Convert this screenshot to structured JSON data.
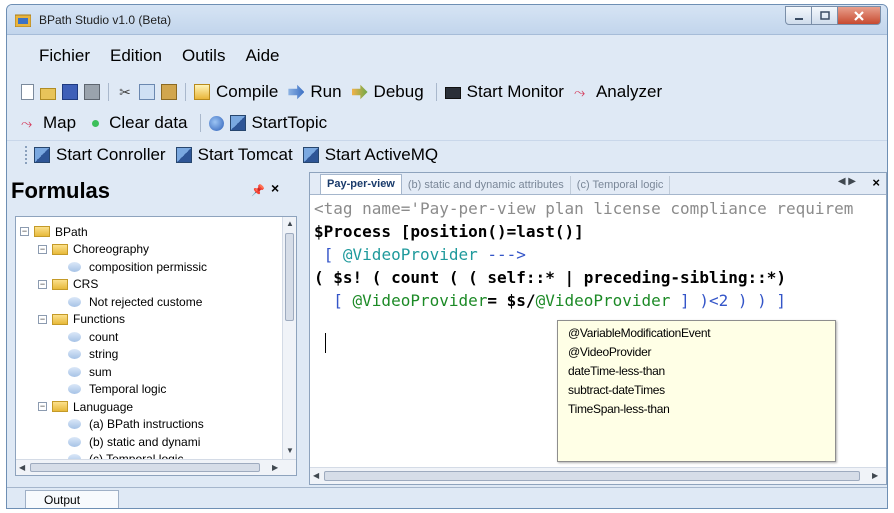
{
  "window": {
    "title": "BPath Studio v1.0 (Beta)"
  },
  "menu": [
    "Fichier",
    "Edition",
    "Outils",
    "Aide"
  ],
  "toolbar1": {
    "compile": "Compile",
    "run": "Run",
    "debug": "Debug",
    "start_monitor": "Start Monitor",
    "analyzer": "Analyzer"
  },
  "toolbar2": {
    "map": "Map",
    "clear_data": "Clear data",
    "start_topic": "StartTopic"
  },
  "toolbar3": {
    "start_controller": "Start Conroller",
    "start_tomcat": "Start Tomcat",
    "start_activemq": "Start ActiveMQ"
  },
  "formulas": {
    "title": "Formulas",
    "pin": "⮟",
    "close": "×",
    "tree": [
      {
        "label": "BPath",
        "type": "folder",
        "level": 0
      },
      {
        "label": "Choreography",
        "type": "folder",
        "level": 1
      },
      {
        "label": "composition permissic",
        "type": "leaf",
        "level": 2
      },
      {
        "label": "CRS",
        "type": "folder",
        "level": 1
      },
      {
        "label": "Not rejected custome",
        "type": "leaf",
        "level": 2
      },
      {
        "label": "Functions",
        "type": "folder",
        "level": 1
      },
      {
        "label": "count",
        "type": "leaf",
        "level": 2
      },
      {
        "label": "string",
        "type": "leaf",
        "level": 2
      },
      {
        "label": "sum",
        "type": "leaf",
        "level": 2
      },
      {
        "label": "Temporal logic",
        "type": "leaf",
        "level": 2
      },
      {
        "label": "Lanuguage",
        "type": "folder",
        "level": 1
      },
      {
        "label": "(a) BPath instructions",
        "type": "leaf",
        "level": 2
      },
      {
        "label": "(b) static and dynami",
        "type": "leaf",
        "level": 2
      },
      {
        "label": "(c) Temporal logic",
        "type": "leaf",
        "level": 2
      }
    ]
  },
  "editor": {
    "tabs": [
      "Pay-per-view",
      "(b) static and dynamic attributes",
      "(c) Temporal logic"
    ],
    "code": {
      "l1": "<tag name='Pay-per-view plan license compliance requirem",
      "l2": "$Process [position()=last()]",
      "l3a": " [ ",
      "l3b": "@VideoProvider",
      "l3c": " --->",
      "l4a": "( $s! ( count ( ( self::* | preceding-sibling::*)",
      "l5a": "  [ ",
      "l5b": "@VideoProvider",
      "l5c": "= $s/",
      "l5d": "@VideoProvider",
      "l5e": " ] )<2 ) ) ]"
    },
    "autocomplete": [
      "@VariableModificationEvent",
      "@VideoProvider",
      "dateTime-less-than",
      "subtract-dateTimes",
      "TimeSpan-less-than"
    ]
  },
  "output": {
    "tab": "Output"
  },
  "colors": {
    "chrome": "#dfe9f5",
    "code_blue": "#3455c8",
    "code_teal": "#1f9a9c",
    "code_green": "#1c8a26",
    "popup": "#ffffe6"
  }
}
